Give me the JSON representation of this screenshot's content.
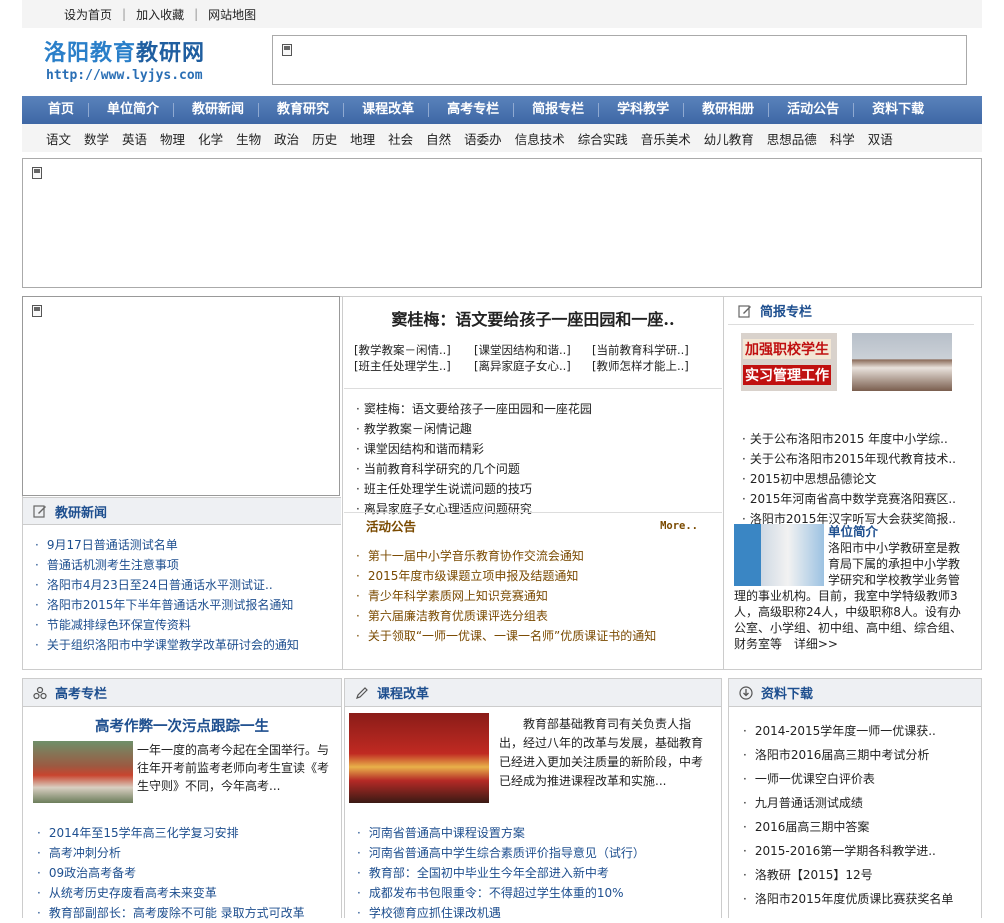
{
  "top_links": [
    "设为首页",
    "加入收藏",
    "网站地图"
  ],
  "logo": {
    "name_a": "洛阳教育",
    "name_b": "教研网",
    "url": "http://www.lyjys.com"
  },
  "nav": [
    "首页",
    "单位简介",
    "教研新闻",
    "教育研究",
    "课程改革",
    "高考专栏",
    "简报专栏",
    "学科教学",
    "教研相册",
    "活动公告",
    "资料下载"
  ],
  "subnav": [
    "语文",
    "数学",
    "英语",
    "物理",
    "化学",
    "生物",
    "政治",
    "历史",
    "地理",
    "社会",
    "自然",
    "语委办",
    "信息技术",
    "综合实践",
    "音乐美术",
    "幼儿教育",
    "思想品德",
    "科学",
    "双语"
  ],
  "headline": {
    "title": "窦桂梅：语文要给孩子一座田园和一座..",
    "links": [
      "[教学教案－闲情..]",
      "[课堂因结构和谐..]",
      "[当前教育科学研..]",
      "[班主任处理学生..]",
      "[离异家庭子女心..]",
      "[教师怎样才能上..]"
    ],
    "items": [
      "窦桂梅：语文要给孩子一座田园和一座花园",
      "教学教案－闲情记趣",
      "课堂因结构和谐而精彩",
      "当前教育科学研究的几个问题",
      "班主任处理学生说谎问题的技巧",
      "离异家庭子女心理适应问题研究"
    ]
  },
  "news": {
    "title": "教研新闻",
    "items": [
      "9月17日普通话测试名单",
      "普通话机测考生注意事项",
      "洛阳市4月23日至24日普通话水平测试证..",
      "洛阳市2015年下半年普通话水平测试报名通知",
      "节能减排绿色环保宣传资料",
      "关于组织洛阳市中学课堂教学改革研讨会的通知"
    ]
  },
  "activity": {
    "title": "活动公告",
    "more": "More..",
    "items": [
      "第十一届中小学音乐教育协作交流会通知",
      "2015年度市级课题立项申报及结题通知",
      "青少年科学素质网上知识竞赛通知",
      "第六届廉洁教育优质课评选分组表",
      "关于领取“一师一优课、一课一名师”优质课证书的通知"
    ]
  },
  "brief": {
    "title": "简报专栏",
    "banner_text_1": "加强职校学生",
    "banner_text_2": "实习管理工作",
    "items": [
      "关于公布洛阳市2015 年度中小学综..",
      "关于公布洛阳市2015年现代教育技术..",
      "2015初中思想品德论文",
      "2015年河南省高中数学竞赛洛阳赛区..",
      "洛阳市2015年汉字听写大会获奖简报.."
    ]
  },
  "unit": {
    "title": "单位简介",
    "text": "洛阳市中小学教研室是教育局下属的承担中小学教学研究和学校教学业务管理的事业机构。目前，我室中学特级教师3人，高级职称24人，中级职称8人。设有办公室、小学组、初中组、高中组、综合组、财务室等",
    "more": "详细>>"
  },
  "gaokao": {
    "title": "高考专栏",
    "headline": "高考作弊一次污点跟踪一生",
    "summary": "一年一度的高考今起在全国举行。与往年开考前监考老师向考生宣读《考生守则》不同，今年高考...",
    "items": [
      "2014年至15学年高三化学复习安排",
      "高考冲刺分析",
      "09政治高考备考",
      "从统考历史存废看高考未来变革",
      "教育部副部长：高考废除不可能 录取方式可改革"
    ]
  },
  "reform": {
    "title": "课程改革",
    "summary": "教育部基础教育司有关负责人指出，经过八年的改革与发展，基础教育已经进入更加关注质量的新阶段，中考已经成为推进课程改革和实施...",
    "items": [
      "河南省普通高中课程设置方案",
      "河南省普通高中学生综合素质评价指导意见（试行）",
      "教育部：全国初中毕业生今年全部进入新中考",
      "成都发布书包限重令：不得超过学生体重的10%",
      "学校德育应抓住课改机遇"
    ]
  },
  "download": {
    "title": "资料下载",
    "items": [
      "2014-2015学年度一师一优课获..",
      "洛阳市2016届高三期中考试分析",
      "一师一优课空白评价表",
      "九月普通话测试成绩",
      "2016届高三期中答案",
      "2015-2016第一学期各科教学进..",
      "洛教研【2015】12号",
      "洛阳市2015年度优质课比赛获奖名单"
    ]
  }
}
